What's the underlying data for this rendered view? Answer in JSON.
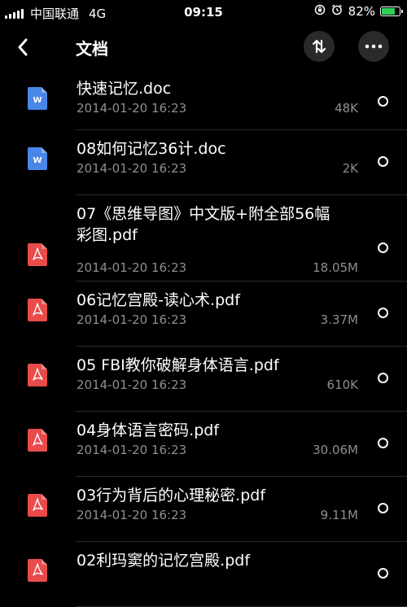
{
  "status_bar": {
    "carrier": "中国联通",
    "network": "4G",
    "time": "09:15",
    "battery": "82%",
    "battery_level": 0.82,
    "battery_color": "#2fd158",
    "icons": [
      "signal-bars-icon",
      "rotation-lock-icon",
      "alarm-icon",
      "battery-icon"
    ]
  },
  "nav": {
    "title": "文档",
    "back_icon": "chevron-left-icon",
    "sort_icon": "sort-arrows-icon",
    "more_icon": "ellipsis-icon"
  },
  "files": [
    {
      "name": "快速记忆.doc",
      "date": "2014-01-20 16:23",
      "size": "48K",
      "type": "doc"
    },
    {
      "name": "08如何记忆36计.doc",
      "date": "2014-01-20 16:23",
      "size": "2K",
      "type": "doc"
    },
    {
      "name": "07《思维导图》中文版+附全部56幅彩图.pdf",
      "date": "2014-01-20 16:23",
      "size": "18.05M",
      "type": "pdf"
    },
    {
      "name": "06记忆宫殿-读心术.pdf",
      "date": "2014-01-20 16:23",
      "size": "3.37M",
      "type": "pdf"
    },
    {
      "name": "05 FBI教你破解身体语言.pdf",
      "date": "2014-01-20 16:23",
      "size": "610K",
      "type": "pdf"
    },
    {
      "name": "04身体语言密码.pdf",
      "date": "2014-01-20 16:23",
      "size": "30.06M",
      "type": "pdf"
    },
    {
      "name": "03行为背后的心理秘密.pdf",
      "date": "2014-01-20 16:23",
      "size": "9.11M",
      "type": "pdf"
    },
    {
      "name": "02利玛窦的记忆宫殿.pdf",
      "date": "",
      "size": "",
      "type": "pdf"
    }
  ],
  "colors": {
    "doc_icon": "#4a86e8",
    "pdf_icon": "#e94b4b",
    "secondary_text": "#8e8e93",
    "button_bg": "#2a2a2c"
  }
}
